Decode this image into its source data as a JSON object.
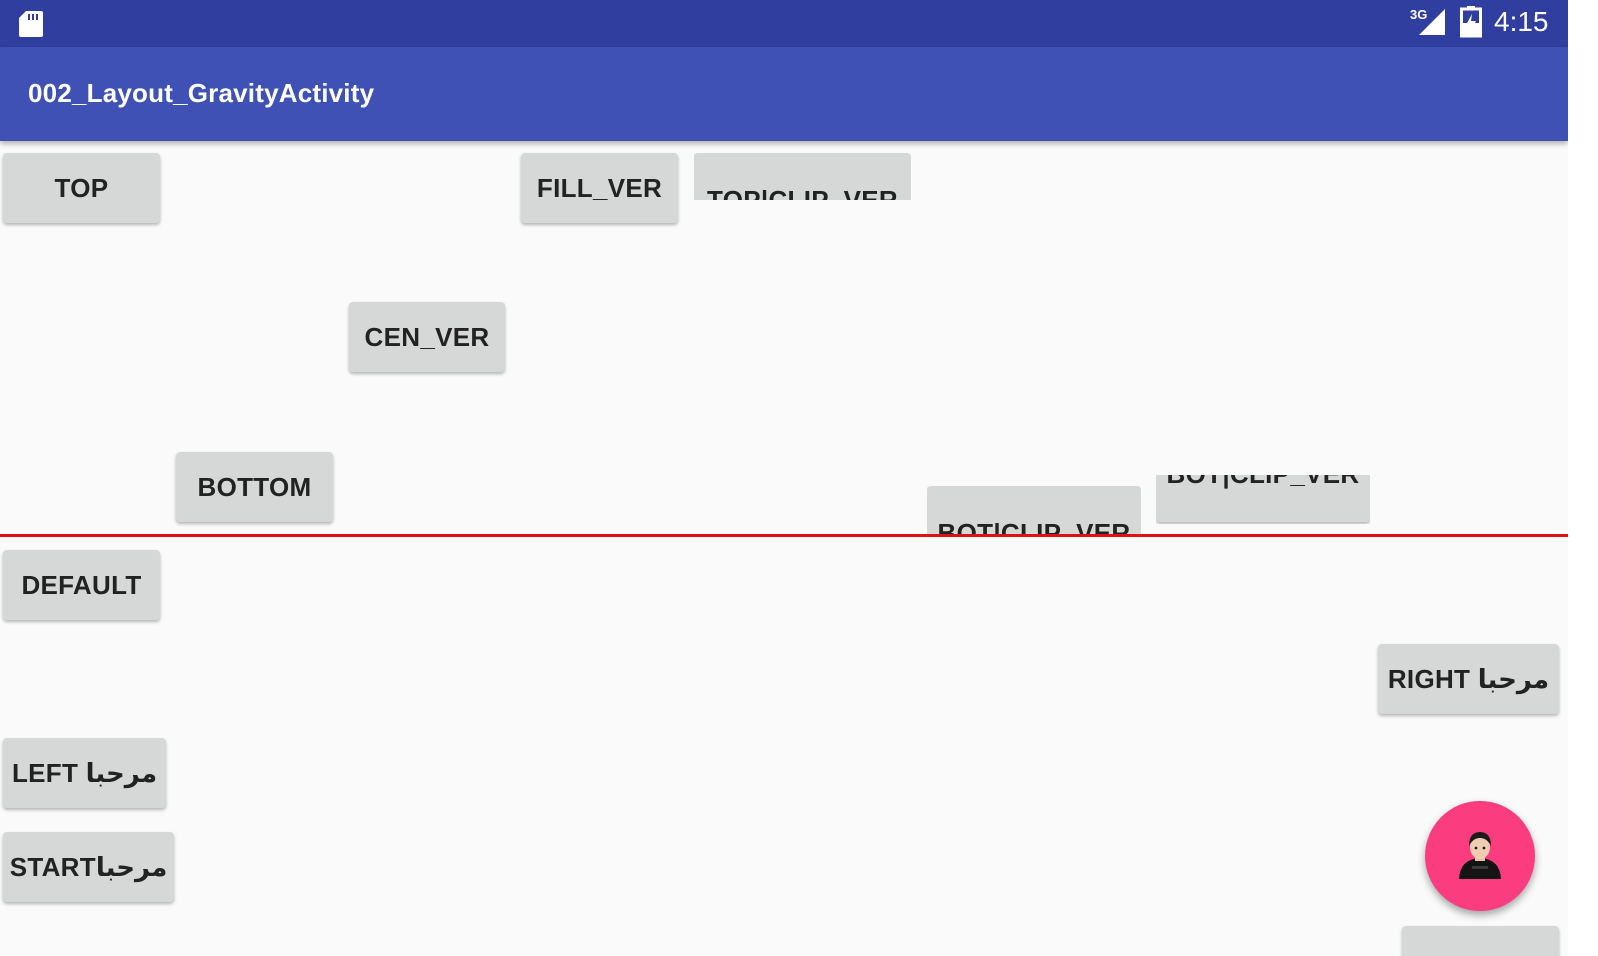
{
  "status_bar": {
    "time": "4:15",
    "network_label": "3G",
    "sd_card_icon": "sd-card-icon",
    "signal_icon": "signal-icon",
    "battery_icon": "battery-charging-icon"
  },
  "app_bar": {
    "title": "002_Layout_GravityActivity",
    "color": "#3f51b5",
    "status_color": "#303f9f"
  },
  "buttons": {
    "top": "TOP",
    "fill_ver": "FILL_VER",
    "top_clip_ver": "TOP|CLIP_VER",
    "cen_ver": "CEN_VER",
    "bottom": "BOTTOM",
    "bot_clip_ver_1": "BOT|CLIP_VER",
    "bot_clip_ver_2": "BOT|CLIP_VER",
    "default": "DEFAULT",
    "right": "RIGHT مرحبا",
    "left": "LEFT مرحبا",
    "start": "STARTمرحبا"
  },
  "divider_color": "#e31010",
  "fab": {
    "icon": "user-avatar-icon",
    "color": "#fb3d80"
  }
}
